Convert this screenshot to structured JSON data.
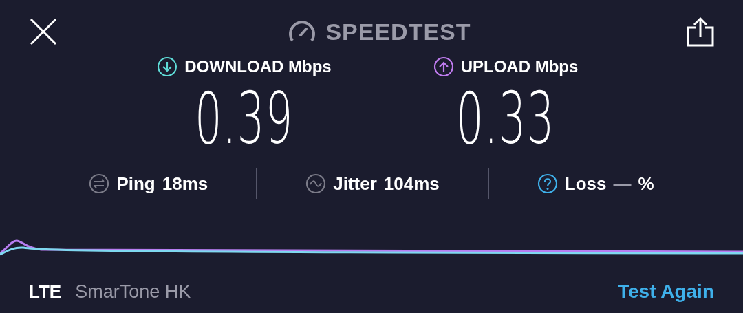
{
  "header": {
    "title": "SPEEDTEST"
  },
  "results": [
    {
      "kind": "download",
      "label": "DOWNLOAD Mbps",
      "value": "0.39"
    },
    {
      "kind": "upload",
      "label": "UPLOAD Mbps",
      "value": "0.33"
    }
  ],
  "stats": [
    {
      "kind": "ping",
      "label": "Ping",
      "value": "18ms"
    },
    {
      "kind": "jitter",
      "label": "Jitter",
      "value": "104ms"
    },
    {
      "kind": "loss",
      "label": "Loss",
      "value": "—",
      "unit": "%"
    }
  ],
  "footer": {
    "network": "LTE",
    "carrier": "SmarTone HK",
    "action": "Test Again"
  }
}
